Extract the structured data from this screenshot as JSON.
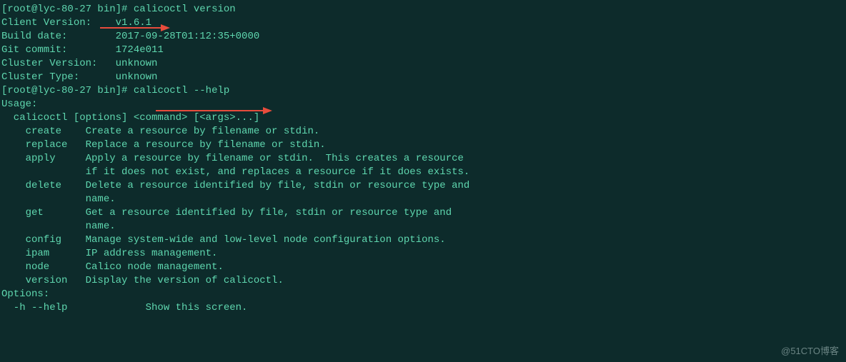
{
  "lines": {
    "l0_prompt_open": "[",
    "l0_prompt_user": "root@lyc-80-27 bin",
    "l0_prompt_close": "]# ",
    "l0_cmd": "calicoctl version",
    "l1": "Client Version:    v1.6.1",
    "l2": "Build date:        2017-09-28T01:12:35+0000",
    "l3": "Git commit:        1724e011",
    "l4": "Cluster Version:   unknown",
    "l5": "Cluster Type:      unknown",
    "l6_prompt_open": "[",
    "l6_prompt_user": "root@lyc-80-27 bin",
    "l6_prompt_close": "]# ",
    "l6_cmd": "calicoctl --help",
    "l7": "Usage:",
    "l8": "  calicoctl [options] <command> [<args>...]",
    "l9": "",
    "l10": "    create    Create a resource by filename or stdin.",
    "l11": "    replace   Replace a resource by filename or stdin.",
    "l12": "    apply     Apply a resource by filename or stdin.  This creates a resource",
    "l13": "              if it does not exist, and replaces a resource if it does exists.",
    "l14": "    delete    Delete a resource identified by file, stdin or resource type and",
    "l15": "              name.",
    "l16": "    get       Get a resource identified by file, stdin or resource type and",
    "l17": "              name.",
    "l18": "    config    Manage system-wide and low-level node configuration options.",
    "l19": "    ipam      IP address management.",
    "l20": "    node      Calico node management.",
    "l21": "    version   Display the version of calicoctl.",
    "l22": "",
    "l23": "Options:",
    "l24": "  -h --help             Show this screen."
  },
  "watermark": "@51CTO博客"
}
